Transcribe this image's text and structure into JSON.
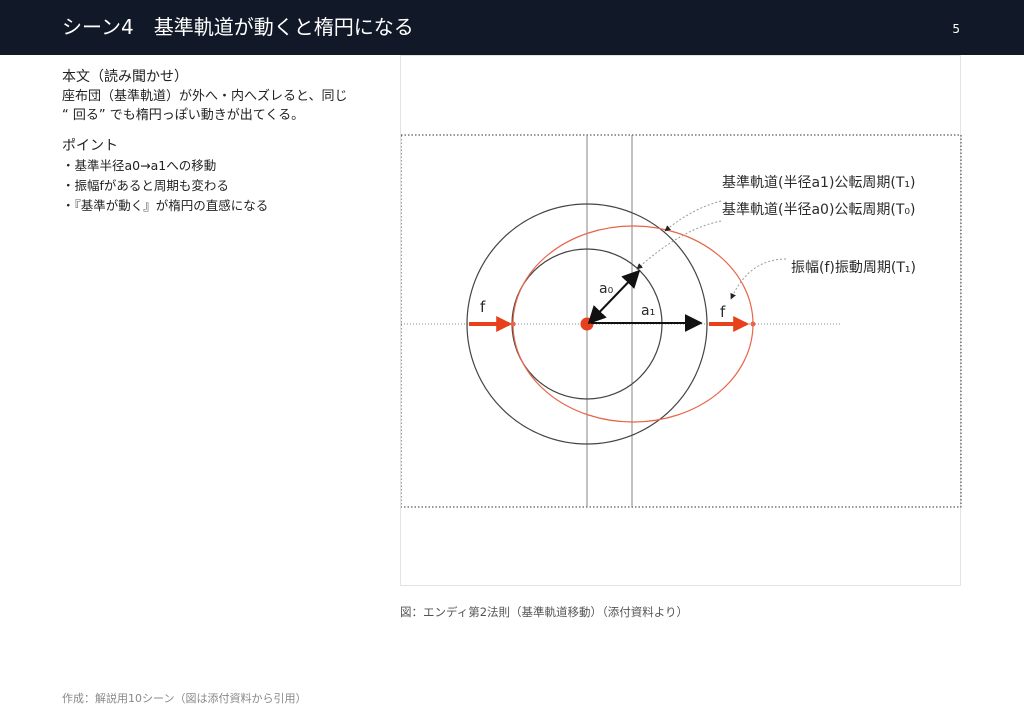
{
  "header": {
    "title": "シーン4　基準軌道が動くと楕円になる",
    "page_number": "5"
  },
  "narration": {
    "heading": "本文（読み聞かせ）",
    "lines": [
      "座布団（基準軌道）が外へ・内へズレると、同じ",
      "“ 回る” でも楕円っぽい動きが出てくる。"
    ]
  },
  "points": {
    "heading": "ポイント",
    "items": [
      "・基準半径a0→a1への移動",
      "・振幅fがあると周期も変わる",
      "・『基準が動く』が楕円の直感になる"
    ]
  },
  "diagram": {
    "labels": {
      "orbit_a1": "基準軌道(半径a1)公転周期(T₁)",
      "orbit_a0": "基準軌道(半径a0)公転周期(T₀)",
      "vibration": "振幅(f)振動周期(T₁)",
      "a0": "a₀",
      "a1": "a₁",
      "f_left": "f",
      "f_right": "f"
    },
    "colors": {
      "circle": "#444444",
      "ellipse": "#e8654a",
      "arrow_red": "#e8401c",
      "center_dot": "#e8401c",
      "leader": "#999999"
    }
  },
  "caption": "図：エンディ第2法則（基準軌道移動）（添付資料より）",
  "footer": "作成：解説用10シーン（図は添付資料から引用）"
}
